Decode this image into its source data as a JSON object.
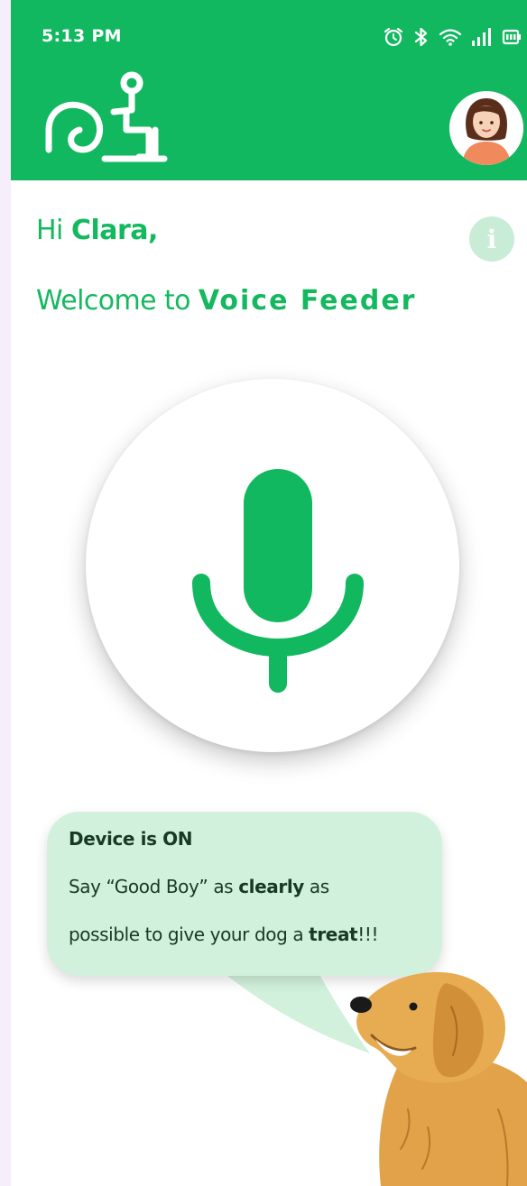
{
  "status_bar": {
    "time": "5:13 PM",
    "icons": [
      "alarm-icon",
      "bluetooth-icon",
      "wifi-icon",
      "signal-icon",
      "battery-icon"
    ]
  },
  "header": {
    "logo_icon": "voice-feeder-logo-icon",
    "avatar_icon": "user-avatar-icon"
  },
  "greeting": {
    "prefix": "Hi",
    "name": "Clara,"
  },
  "info_button": {
    "glyph": "i"
  },
  "welcome": {
    "prefix": "Welcome to",
    "app_name": "Voice Feeder"
  },
  "mic_button": {
    "icon": "microphone-icon"
  },
  "message": {
    "status": "Device is ON",
    "line2_pre": "Say “Good Boy” as",
    "line2_bold": "clearly",
    "line2_post": "as",
    "line3_pre": "possible to give your dog a",
    "line3_bold": "treat",
    "line3_post": "!!!"
  },
  "illustration": {
    "icon": "golden-retriever-dog-illustration"
  },
  "colors": {
    "brand_green": "#12b85f",
    "bubble_green": "#d2f1dc",
    "info_green": "#c8ecd6",
    "background": "#f6eefa"
  }
}
